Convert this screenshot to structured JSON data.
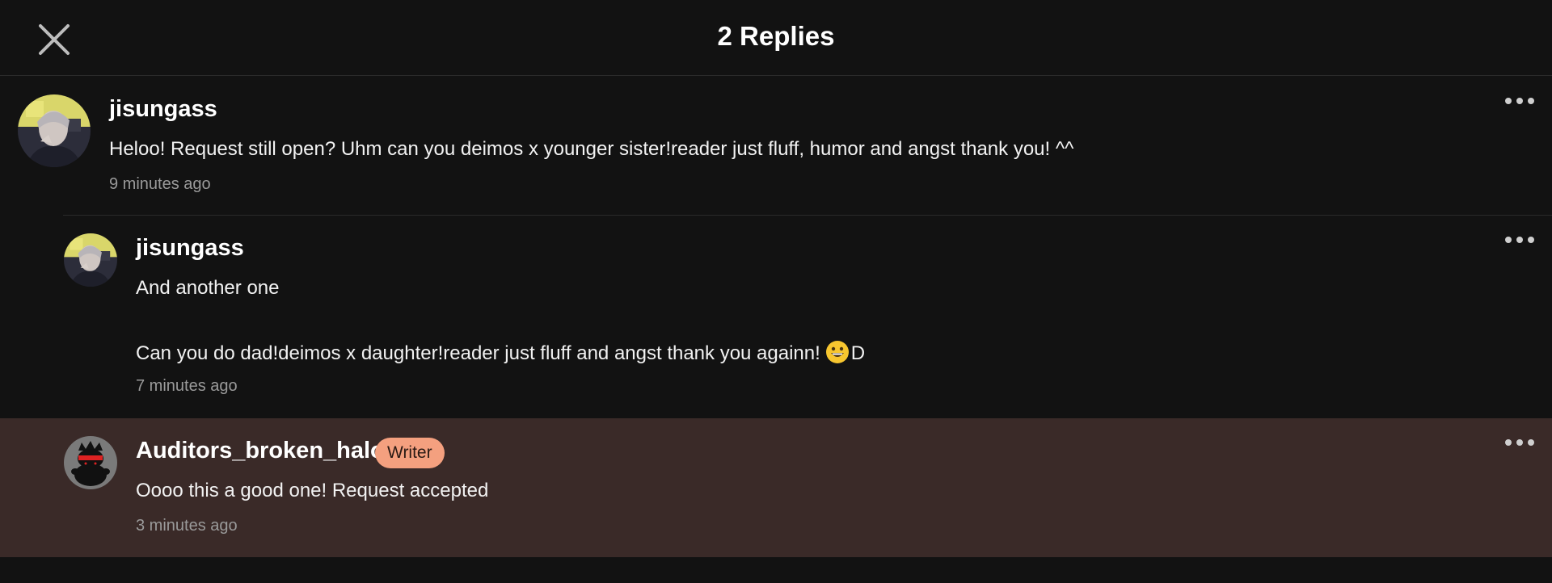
{
  "header": {
    "title": "2 Replies",
    "close_icon": "close-icon"
  },
  "comments": [
    {
      "username": "jisungass",
      "text": "Heloo! Request still open? Uhm can you deimos x younger sister!reader just fluff, humor and angst thank you! ^^",
      "time": "9 minutes ago",
      "avatar_icon": "user-avatar-photo"
    },
    {
      "username": "jisungass",
      "text_line_1": "And another one",
      "text_line_2": "Can you do dad!deimos x daughter!reader just fluff and angst thank you againn!",
      "text_line_2_suffix": "D",
      "emoji_icon": "grinning-face-icon",
      "time": "7 minutes ago",
      "avatar_icon": "user-avatar-photo"
    },
    {
      "username": "Auditors_broken_halo",
      "badge": "Writer",
      "text": "Oooo this a good one! Request accepted",
      "time": "3 minutes ago",
      "avatar_icon": "writer-avatar-image"
    }
  ],
  "colors": {
    "background": "#121212",
    "highlight_row": "#3a2a28",
    "badge": "#f4a07f",
    "timestamp": "#9a9a9a"
  },
  "more_icon": "more-options-icon"
}
